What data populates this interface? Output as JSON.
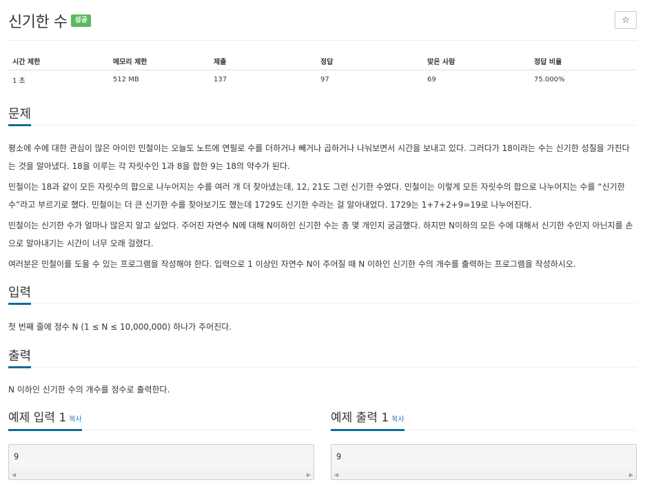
{
  "title": "신기한 수",
  "badge": "성공",
  "star_icon": "☆",
  "info": {
    "headers": [
      "시간 제한",
      "메모리 제한",
      "제출",
      "정답",
      "맞은 사람",
      "정답 비율"
    ],
    "values": [
      "1 초",
      "512 MB",
      "137",
      "97",
      "69",
      "75.000%"
    ]
  },
  "sections": {
    "problem": {
      "heading": "문제",
      "paragraphs": [
        "평소에 수에 대한 관심이 많은 아이인 민철이는 오늘도 노트에 연필로 수를 더하거나 빼거나 곱하거나 나눠보면서 시간을 보내고 있다. 그러다가 18이라는 수는 신기한 성질을 가진다는 것을 알아냈다. 18을 이루는 각 자릿수인 1과 8을 합한 9는 18의 약수가 된다.",
        "민철이는 18과 같이 모든 자릿수의 합으로 나누어지는 수를 여러 개 더 찾아냈는데, 12, 21도 그런 신기한 수였다. 민철이는 이렇게 모든 자릿수의 합으로 나누어지는 수를 “신기한 수”라고 부르기로 했다. 민철이는 더 큰 신기한 수를 찾아보기도 했는데 1729도 신기한 수라는 걸 알아내었다. 1729는 1+7+2+9=19로 나누어진다.",
        "민철이는 신기한 수가 얼마나 많은지 알고 싶었다. 주어진 자연수 N에 대해 N이하인 신기한 수는 총 몇 개인지 궁금했다. 하지만 N이하의 모든 수에 대해서 신기한 수인지 아닌지를 손으로 알아내기는 시간이 너무 오래 걸렸다.",
        "여러분은 민철이를 도울 수 있는 프로그램을 작성해야 한다. 입력으로 1 이상인 자연수 N이 주어질 때 N 이하인 신기한 수의 개수를 출력하는 프로그램을 작성하시오."
      ]
    },
    "input": {
      "heading": "입력",
      "text": "첫 번째 줄에 정수 N (1 ≤ N ≤ 10,000,000) 하나가 주어진다."
    },
    "output": {
      "heading": "출력",
      "text": "N 이하인 신기한 수의 개수를 정수로 출력한다."
    }
  },
  "samples": {
    "input": {
      "heading": "예제 입력 1",
      "copy": "복사",
      "value": "9"
    },
    "output": {
      "heading": "예제 출력 1",
      "copy": "복사",
      "value": "9"
    },
    "scroll_left": "◀",
    "scroll_right": "▶"
  }
}
